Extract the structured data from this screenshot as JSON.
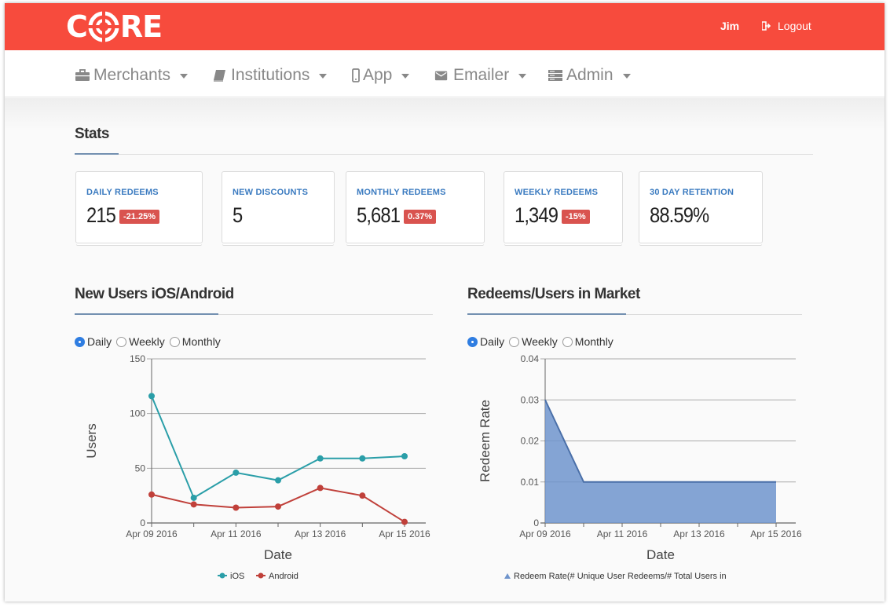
{
  "header": {
    "logo_text": "CORE",
    "user_name": "Jim",
    "logout_label": "Logout",
    "brand_color": "#f74b3d"
  },
  "nav": {
    "items": [
      {
        "label": "Merchants",
        "icon": "briefcase-icon"
      },
      {
        "label": "Institutions",
        "icon": "book-icon"
      },
      {
        "label": "App",
        "icon": "mobile-icon"
      },
      {
        "label": "Emailer",
        "icon": "envelope-icon"
      },
      {
        "label": "Admin",
        "icon": "server-icon"
      }
    ]
  },
  "stats": {
    "title": "Stats",
    "cards": [
      {
        "label": "DAILY REDEEMS",
        "value": "215",
        "badge": "-21.25%"
      },
      {
        "label": "NEW DISCOUNTS",
        "value": "5",
        "badge": ""
      },
      {
        "label": "MONTHLY REDEEMS",
        "value": "5,681",
        "badge": "0.37%"
      },
      {
        "label": "WEEKLY REDEEMS",
        "value": "1,349",
        "badge": "-15%"
      },
      {
        "label": "30 DAY RETENTION",
        "value": "88.59%",
        "badge": ""
      }
    ]
  },
  "users_panel": {
    "title": "New Users iOS/Android",
    "radios": [
      {
        "label": "Daily",
        "selected": true
      },
      {
        "label": "Weekly",
        "selected": false
      },
      {
        "label": "Monthly",
        "selected": false
      }
    ]
  },
  "redeems_panel": {
    "title": "Redeems/Users in Market",
    "radios": [
      {
        "label": "Daily",
        "selected": true
      },
      {
        "label": "Weekly",
        "selected": false
      },
      {
        "label": "Monthly",
        "selected": false
      }
    ]
  },
  "chart_data": [
    {
      "type": "line",
      "title": "",
      "xlabel": "Date",
      "ylabel": "Users",
      "x": [
        "Apr 09 2016",
        "Apr 10 2016",
        "Apr 11 2016",
        "Apr 12 2016",
        "Apr 13 2016",
        "Apr 14 2016",
        "Apr 15 2016"
      ],
      "x_tick_labels": [
        "Apr 09 2016",
        "Apr 11 2016",
        "Apr 13 2016",
        "Apr 15 2016"
      ],
      "y_ticks": [
        0,
        50,
        100,
        150
      ],
      "ylim": [
        0,
        150
      ],
      "grid": true,
      "legend_position": "bottom",
      "series": [
        {
          "name": "iOS",
          "color": "#2a9ea8",
          "values": [
            116,
            23,
            46,
            39,
            59,
            59,
            61
          ]
        },
        {
          "name": "Android",
          "color": "#c0403a",
          "values": [
            26,
            17,
            14,
            15,
            32,
            25,
            1
          ]
        }
      ]
    },
    {
      "type": "area",
      "title": "",
      "xlabel": "Date",
      "ylabel": "Redeem Rate",
      "x": [
        "Apr 09 2016",
        "Apr 10 2016",
        "Apr 11 2016",
        "Apr 12 2016",
        "Apr 13 2016",
        "Apr 14 2016",
        "Apr 15 2016"
      ],
      "x_tick_labels": [
        "Apr 09 2016",
        "Apr 11 2016",
        "Apr 13 2016",
        "Apr 15 2016"
      ],
      "y_ticks": [
        0,
        0.01,
        0.02,
        0.03,
        0.04
      ],
      "ylim": [
        0,
        0.04
      ],
      "grid": true,
      "legend_position": "bottom",
      "series": [
        {
          "name": "Redeem Rate(# Unique User Redeems/# Total Users in",
          "color": "#6f94cc",
          "values": [
            0.03,
            0.01,
            0.01,
            0.01,
            0.01,
            0.01,
            0.01
          ]
        }
      ]
    }
  ]
}
